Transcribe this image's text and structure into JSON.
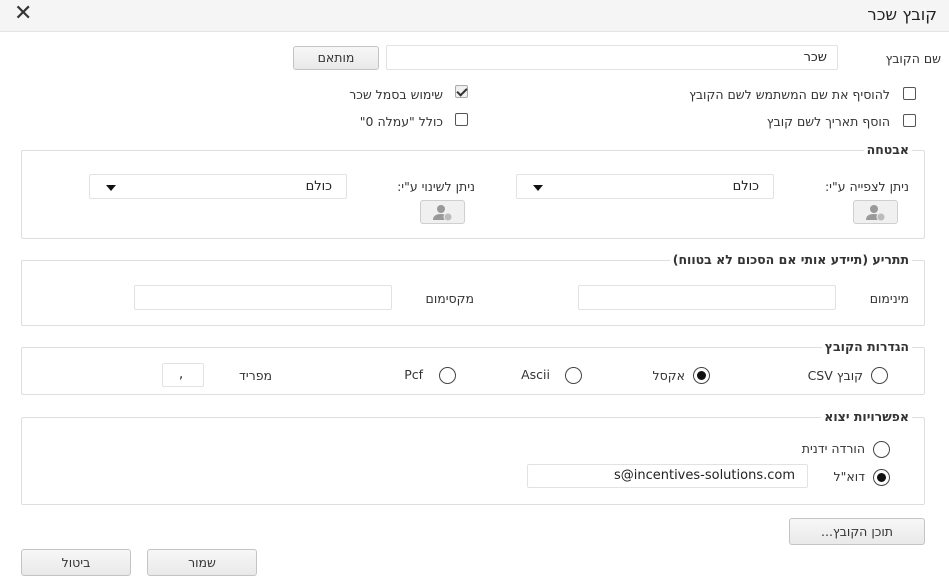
{
  "dialog": {
    "title": "קובץ שכר",
    "close_glyph": "✕"
  },
  "file_name": {
    "label": "שם הקובץ",
    "value": "שכר",
    "custom_button": "מותאם"
  },
  "options": {
    "add_username": "להוסיף את שם המשתמש לשם הקובץ",
    "add_date": "הוסף תאריך לשם קובץ",
    "use_payroll_symbol": "שימוש בסמל שכר",
    "include_zero_commission": "כולל \"עמלה 0\""
  },
  "security": {
    "legend": "אבטחה",
    "view_label": "ניתן לצפייה ע\"י:",
    "view_value": "כולם",
    "edit_label": "ניתן לשינוי ע\"י:",
    "edit_value": "כולם"
  },
  "alert": {
    "legend": "תתריע (תיידע אותי אם הסכום לא בטווח)",
    "min_label": "מינימום",
    "max_label": "מקסימום"
  },
  "file_settings": {
    "legend": "הגדרות הקובץ",
    "csv_label": "קובץ CSV",
    "excel_label": "אקסל",
    "ascii_label": "Ascii",
    "pcf_label": "Pcf",
    "separator_label": "מפריד",
    "separator_value": ","
  },
  "output": {
    "legend": "אפשרויות יצוא",
    "manual_download": "הורדה ידנית",
    "email_label": "דוא\"ל",
    "email_value": "s@incentives-solutions.com"
  },
  "footer": {
    "file_content_button": "תוכן הקובץ...",
    "save_button": "שמור",
    "cancel_button": "ביטול"
  },
  "colors": {
    "accent": "#111111",
    "border": "#dedede"
  }
}
